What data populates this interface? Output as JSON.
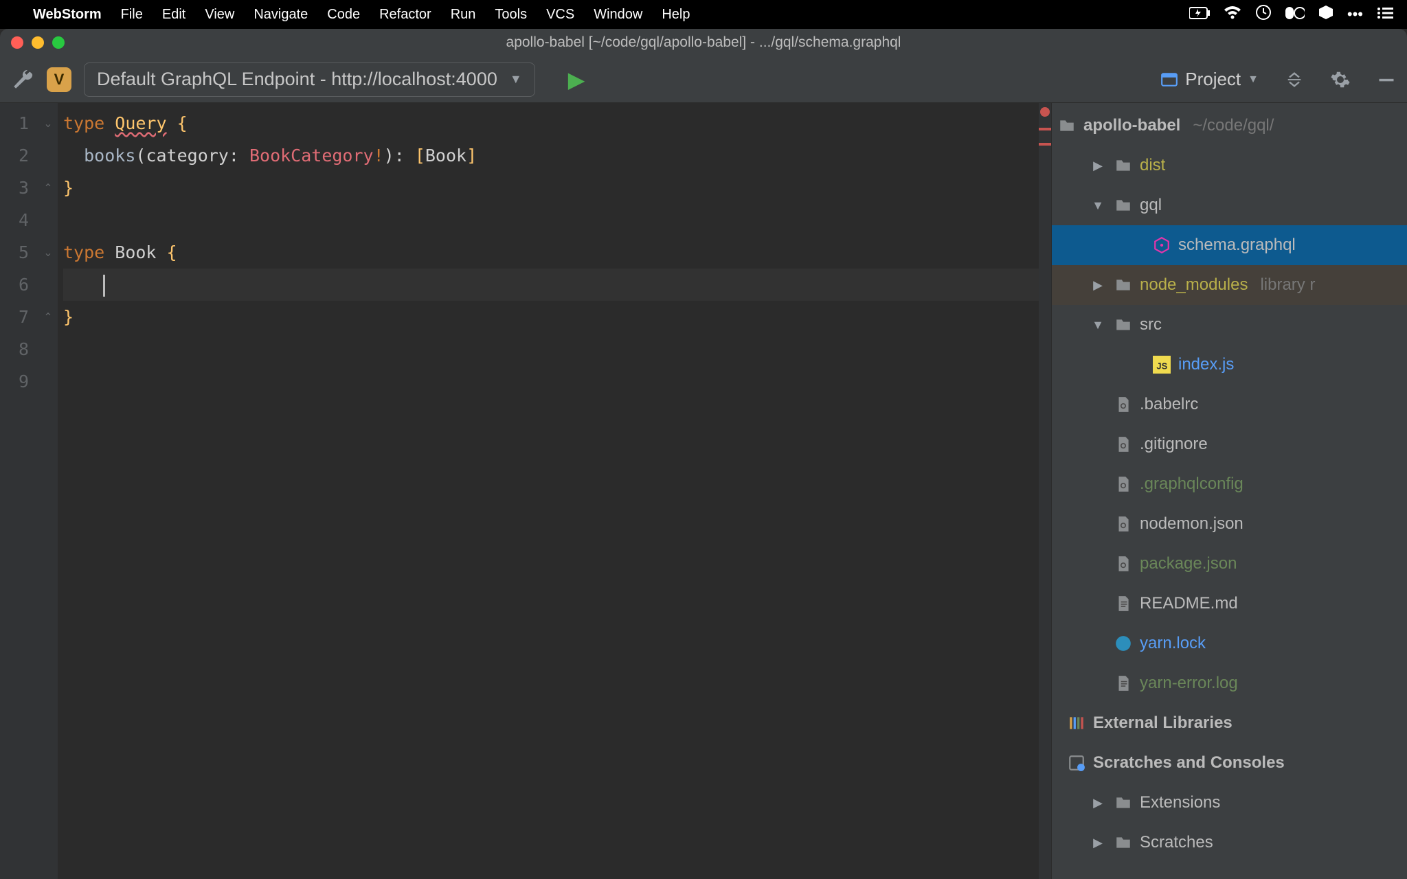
{
  "menubar": {
    "app": "WebStorm",
    "items": [
      "File",
      "Edit",
      "View",
      "Navigate",
      "Code",
      "Refactor",
      "Run",
      "Tools",
      "VCS",
      "Window",
      "Help"
    ]
  },
  "titlebar": {
    "title": "apollo-babel [~/code/gql/apollo-babel] - .../gql/schema.graphql"
  },
  "toolbar": {
    "badge": "V",
    "endpoint_label": "Default GraphQL Endpoint - http://localhost:4000",
    "project_label": "Project"
  },
  "editor": {
    "line_count": 9,
    "current_line": 6,
    "tokens": [
      [
        [
          "kw",
          "type "
        ],
        [
          "ty underline",
          "Query"
        ],
        [
          "id",
          " "
        ],
        [
          "brace",
          "{"
        ]
      ],
      [
        [
          "id",
          "  "
        ],
        [
          "fn",
          "books"
        ],
        [
          "id",
          "("
        ],
        [
          "id",
          "category"
        ],
        [
          "id",
          ": "
        ],
        [
          "type2",
          "BookCategory"
        ],
        [
          "punc",
          "!"
        ],
        [
          "id",
          "): "
        ],
        [
          "bracket",
          "["
        ],
        [
          "id",
          "Book"
        ],
        [
          "bracket",
          "]"
        ]
      ],
      [
        [
          "brace",
          "}"
        ]
      ],
      [
        [
          "id",
          ""
        ]
      ],
      [
        [
          "kw",
          "type "
        ],
        [
          "id",
          "Book "
        ],
        [
          "brace",
          "{"
        ]
      ],
      [
        [
          "id",
          "  "
        ],
        [
          "caret",
          ""
        ]
      ],
      [
        [
          "brace",
          "}"
        ]
      ],
      [
        [
          "id",
          ""
        ]
      ],
      [
        [
          "id",
          ""
        ]
      ]
    ],
    "fold": [
      "down",
      "",
      "up",
      "",
      "down",
      "",
      "up",
      "",
      ""
    ]
  },
  "project": {
    "root": {
      "label": "apollo-babel",
      "hint": "~/code/gql/"
    },
    "nodes": [
      {
        "indent": 1,
        "arrow": "closed",
        "icon": "folder",
        "label": "dist",
        "cls": "c-yellow"
      },
      {
        "indent": 1,
        "arrow": "open",
        "icon": "folder",
        "label": "gql",
        "cls": "c-gray"
      },
      {
        "indent": 2,
        "arrow": "none",
        "icon": "graphql",
        "label": "schema.graphql",
        "cls": "c-gray",
        "sel": true
      },
      {
        "indent": 1,
        "arrow": "closed",
        "icon": "folder",
        "label": "node_modules",
        "hint": "library r",
        "cls": "c-yellow",
        "dim": true
      },
      {
        "indent": 1,
        "arrow": "open",
        "icon": "folder",
        "label": "src",
        "cls": "c-gray"
      },
      {
        "indent": 2,
        "arrow": "none",
        "icon": "js",
        "label": "index.js",
        "cls": "c-blue"
      },
      {
        "indent": 1,
        "arrow": "none",
        "icon": "cfg",
        "label": ".babelrc",
        "cls": "c-gray"
      },
      {
        "indent": 1,
        "arrow": "none",
        "icon": "cfg",
        "label": ".gitignore",
        "cls": "c-gray"
      },
      {
        "indent": 1,
        "arrow": "none",
        "icon": "cfg",
        "label": ".graphqlconfig",
        "cls": "c-green"
      },
      {
        "indent": 1,
        "arrow": "none",
        "icon": "cfg",
        "label": "nodemon.json",
        "cls": "c-gray"
      },
      {
        "indent": 1,
        "arrow": "none",
        "icon": "cfg",
        "label": "package.json",
        "cls": "c-green"
      },
      {
        "indent": 1,
        "arrow": "none",
        "icon": "txt",
        "label": "README.md",
        "cls": "c-gray"
      },
      {
        "indent": 1,
        "arrow": "none",
        "icon": "yarn",
        "label": "yarn.lock",
        "cls": "c-blue"
      },
      {
        "indent": 1,
        "arrow": "none",
        "icon": "txt",
        "label": "yarn-error.log",
        "cls": "c-green"
      }
    ],
    "extra": [
      {
        "icon": "lib",
        "label": "External Libraries"
      },
      {
        "icon": "scratch",
        "label": "Scratches and Consoles"
      },
      {
        "indent": 1,
        "arrow": "closed",
        "icon": "folder",
        "label": "Extensions",
        "cls": "c-gray"
      },
      {
        "indent": 1,
        "arrow": "closed",
        "icon": "folder",
        "label": "Scratches",
        "cls": "c-gray"
      }
    ]
  }
}
